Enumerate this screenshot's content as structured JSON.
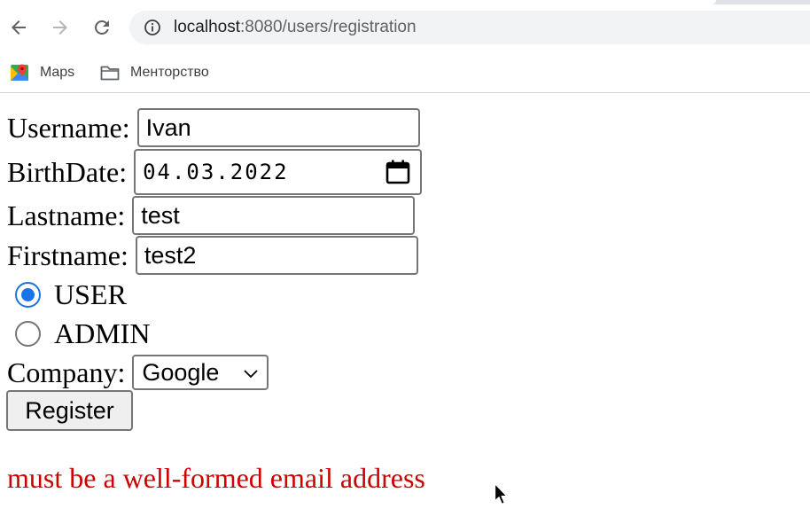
{
  "browser": {
    "url_host": "localhost",
    "url_path": ":8080/users/registration",
    "bookmarks": [
      {
        "label": "Maps",
        "icon": "maps-icon"
      },
      {
        "label": "Менторство",
        "icon": "folder-icon"
      }
    ]
  },
  "form": {
    "username": {
      "label": "Username:",
      "value": "Ivan"
    },
    "birthdate": {
      "label": "BirthDate:",
      "value": "04.03.2022"
    },
    "lastname": {
      "label": "Lastname:",
      "value": "test"
    },
    "firstname": {
      "label": "Firstname:",
      "value": "test2"
    },
    "roles": [
      {
        "label": "USER",
        "checked": true
      },
      {
        "label": "ADMIN",
        "checked": false
      }
    ],
    "company": {
      "label": "Company:",
      "selected": "Google"
    },
    "submit_label": "Register"
  },
  "error": {
    "message": "must be a well-formed email address"
  },
  "colors": {
    "accent": "#1a73e8",
    "error": "#cc0000",
    "input_border": "#767676"
  }
}
